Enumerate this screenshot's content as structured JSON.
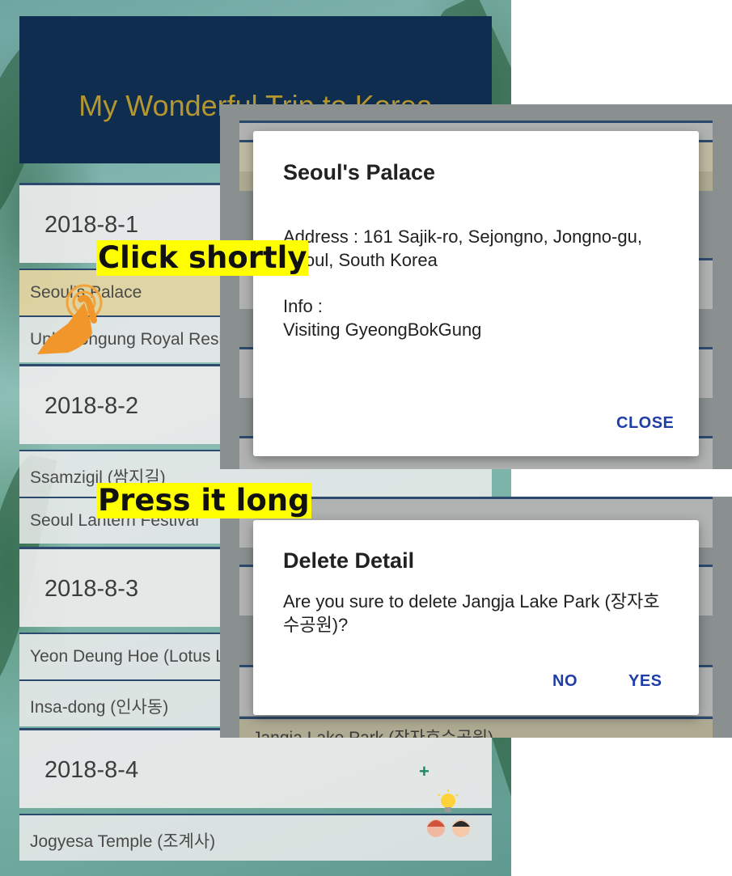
{
  "app": {
    "title": "My Wonderful Trip to Korea"
  },
  "days": [
    {
      "date": "2018-8-1",
      "details": [
        "Seoul's Palace",
        "Unhyeongung Royal Residence"
      ]
    },
    {
      "date": "2018-8-2",
      "details": [
        "Ssamzigil (쌈지길)",
        "Seoul Lantern Festival"
      ]
    },
    {
      "date": "2018-8-3",
      "details": [
        "Yeon Deung Hoe (Lotus Lantern Festival)",
        "Insa-dong (인사동)"
      ]
    },
    {
      "date": "2018-8-4",
      "add_label": "+",
      "details": [
        "Jogyesa Temple (조계사)"
      ]
    }
  ],
  "dialog_info": {
    "title": "Seoul's Palace",
    "address": "Address : 161 Sajik-ro, Sejongno, Jongno-gu, Seoul, South Korea",
    "info_label": "Info :",
    "info_value": "Visiting GyeongBokGung",
    "close_label": "CLOSE"
  },
  "dialog_delete": {
    "title": "Delete Detail",
    "message": "Are you sure to delete Jangja Lake Park (장자호수공원)?",
    "no_label": "NO",
    "yes_label": "YES",
    "behind_text": "Jangja Lake Park (장자호수공원)"
  },
  "annotations": {
    "click": "Click shortly",
    "press": "Press it long"
  },
  "colors": {
    "header_bg": "#0e2d4f",
    "title_gold": "#b6962e",
    "highlight": "#e6d6a2",
    "button_blue": "#1f3ea8",
    "annotation_yellow": "#ffff00"
  }
}
